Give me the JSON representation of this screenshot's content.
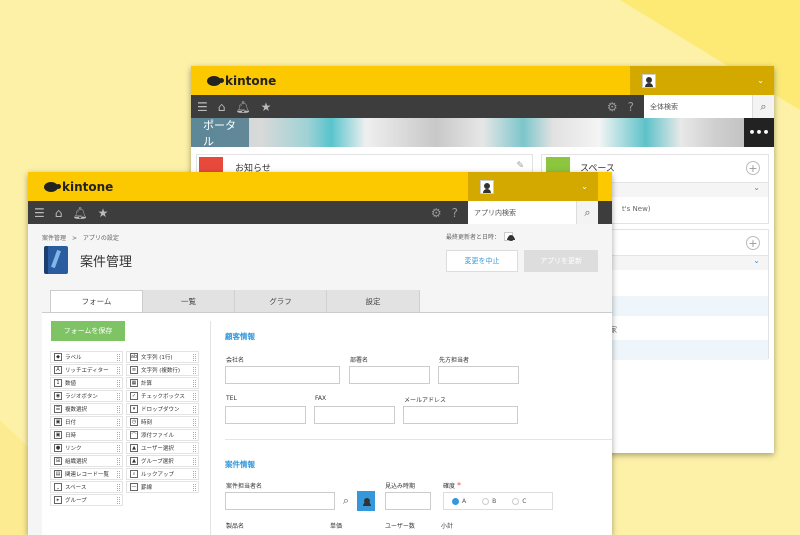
{
  "back_window": {
    "logo": "kintone",
    "search_placeholder": "全体検索",
    "banner_label": "ポータル",
    "more_label": "•••",
    "notices_title": "お知らせ",
    "spaces_title": "スペース",
    "whats_new_snippet": "t's New)",
    "list_snippet": "家"
  },
  "front_window": {
    "logo": "kintone",
    "search_placeholder": "アプリ内検索",
    "breadcrumb": {
      "root": "案件管理",
      "separator": ">",
      "current": "アプリの設定"
    },
    "last_updated": "最終更新者と日時：",
    "app_title": "案件管理",
    "discard_label": "変更を中止",
    "update_label": "アプリを更新",
    "tabs": [
      "フォーム",
      "一覧",
      "グラフ",
      "設定"
    ],
    "save_form_label": "フォームを保存",
    "palette": [
      {
        "icon": "label-icon",
        "glyph": "◆",
        "label": "ラベル"
      },
      {
        "icon": "text-single-icon",
        "glyph": "ab",
        "label": "文字列 (1行)"
      },
      {
        "icon": "rich-editor-icon",
        "glyph": "A",
        "label": "リッチエディター"
      },
      {
        "icon": "text-multi-icon",
        "glyph": "≡",
        "label": "文字列 (複数行)"
      },
      {
        "icon": "number-icon",
        "glyph": "1",
        "label": "数値"
      },
      {
        "icon": "calc-icon",
        "glyph": "▦",
        "label": "計算"
      },
      {
        "icon": "radio-icon",
        "glyph": "◉",
        "label": "ラジオボタン"
      },
      {
        "icon": "checkbox-icon",
        "glyph": "✓",
        "label": "チェックボックス"
      },
      {
        "icon": "multi-select-icon",
        "glyph": "☰",
        "label": "複数選択"
      },
      {
        "icon": "dropdown-icon",
        "glyph": "▾",
        "label": "ドロップダウン"
      },
      {
        "icon": "date-icon",
        "glyph": "▣",
        "label": "日付"
      },
      {
        "icon": "time-icon",
        "glyph": "◷",
        "label": "時刻"
      },
      {
        "icon": "datetime-icon",
        "glyph": "▣",
        "label": "日時"
      },
      {
        "icon": "attachment-icon",
        "glyph": "⌒",
        "label": "添付ファイル"
      },
      {
        "icon": "link-icon",
        "glyph": "●",
        "label": "リンク"
      },
      {
        "icon": "user-select-icon",
        "glyph": "▲",
        "label": "ユーザー選択"
      },
      {
        "icon": "org-select-icon",
        "glyph": "⊞",
        "label": "組織選択"
      },
      {
        "icon": "group-select-icon",
        "glyph": "▲",
        "label": "グループ選択"
      },
      {
        "icon": "related-records-icon",
        "glyph": "▤",
        "label": "関連レコード一覧"
      },
      {
        "icon": "lookup-icon",
        "glyph": "⌕",
        "label": "ルックアップ"
      },
      {
        "icon": "space-icon",
        "glyph": "⎵",
        "label": "スペース"
      },
      {
        "icon": "border-icon",
        "glyph": "—",
        "label": "罫線"
      },
      {
        "icon": "group-icon",
        "glyph": "▸",
        "label": "グループ"
      }
    ],
    "section1": "顧客情報",
    "fields1": {
      "company": "会社名",
      "dept": "部署名",
      "contact": "先方担当者",
      "tel": "TEL",
      "fax": "FAX",
      "mail": "メールアドレス"
    },
    "section2": "案件情報",
    "fields2": {
      "owner": "案件担当者名",
      "period": "見込み時期",
      "certainty": "確度",
      "required": "*",
      "product": "製品名",
      "price": "単価",
      "users": "ユーザー数",
      "subtotal": "小計"
    },
    "radio_options": [
      "A",
      "B",
      "C"
    ]
  },
  "colors": {
    "brand_yellow": "#fcc800",
    "accent_blue": "#3498db",
    "save_green": "#7fc464"
  }
}
